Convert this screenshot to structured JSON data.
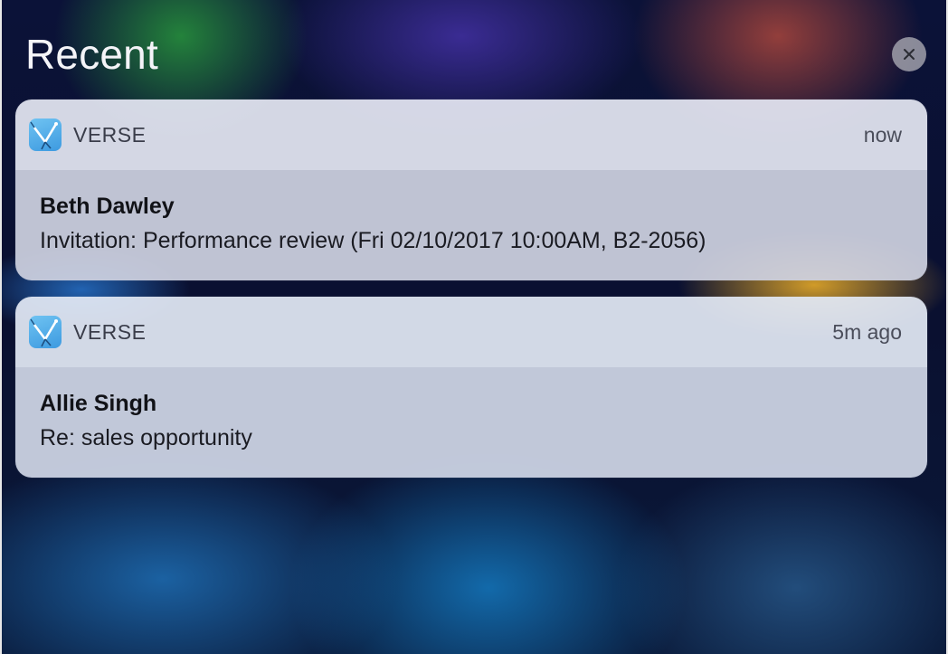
{
  "header": {
    "title": "Recent",
    "close_icon": "close-icon"
  },
  "notifications": [
    {
      "app_name": "VERSE",
      "app_icon": "verse-app-icon",
      "time": "now",
      "sender": "Beth Dawley",
      "message": "Invitation: Performance review (Fri 02/10/2017 10:00AM, B2-2056)"
    },
    {
      "app_name": "VERSE",
      "app_icon": "verse-app-icon",
      "time": "5m ago",
      "sender": "Allie Singh",
      "message": "Re: sales opportunity"
    }
  ],
  "colors": {
    "title_text": "#f4f4f8",
    "close_button_bg": "#a0a0aa",
    "card_header_bg": "#e4e6f2",
    "card_body_bg": "#ced1e0",
    "app_icon_blue": "#4aa6e6"
  }
}
